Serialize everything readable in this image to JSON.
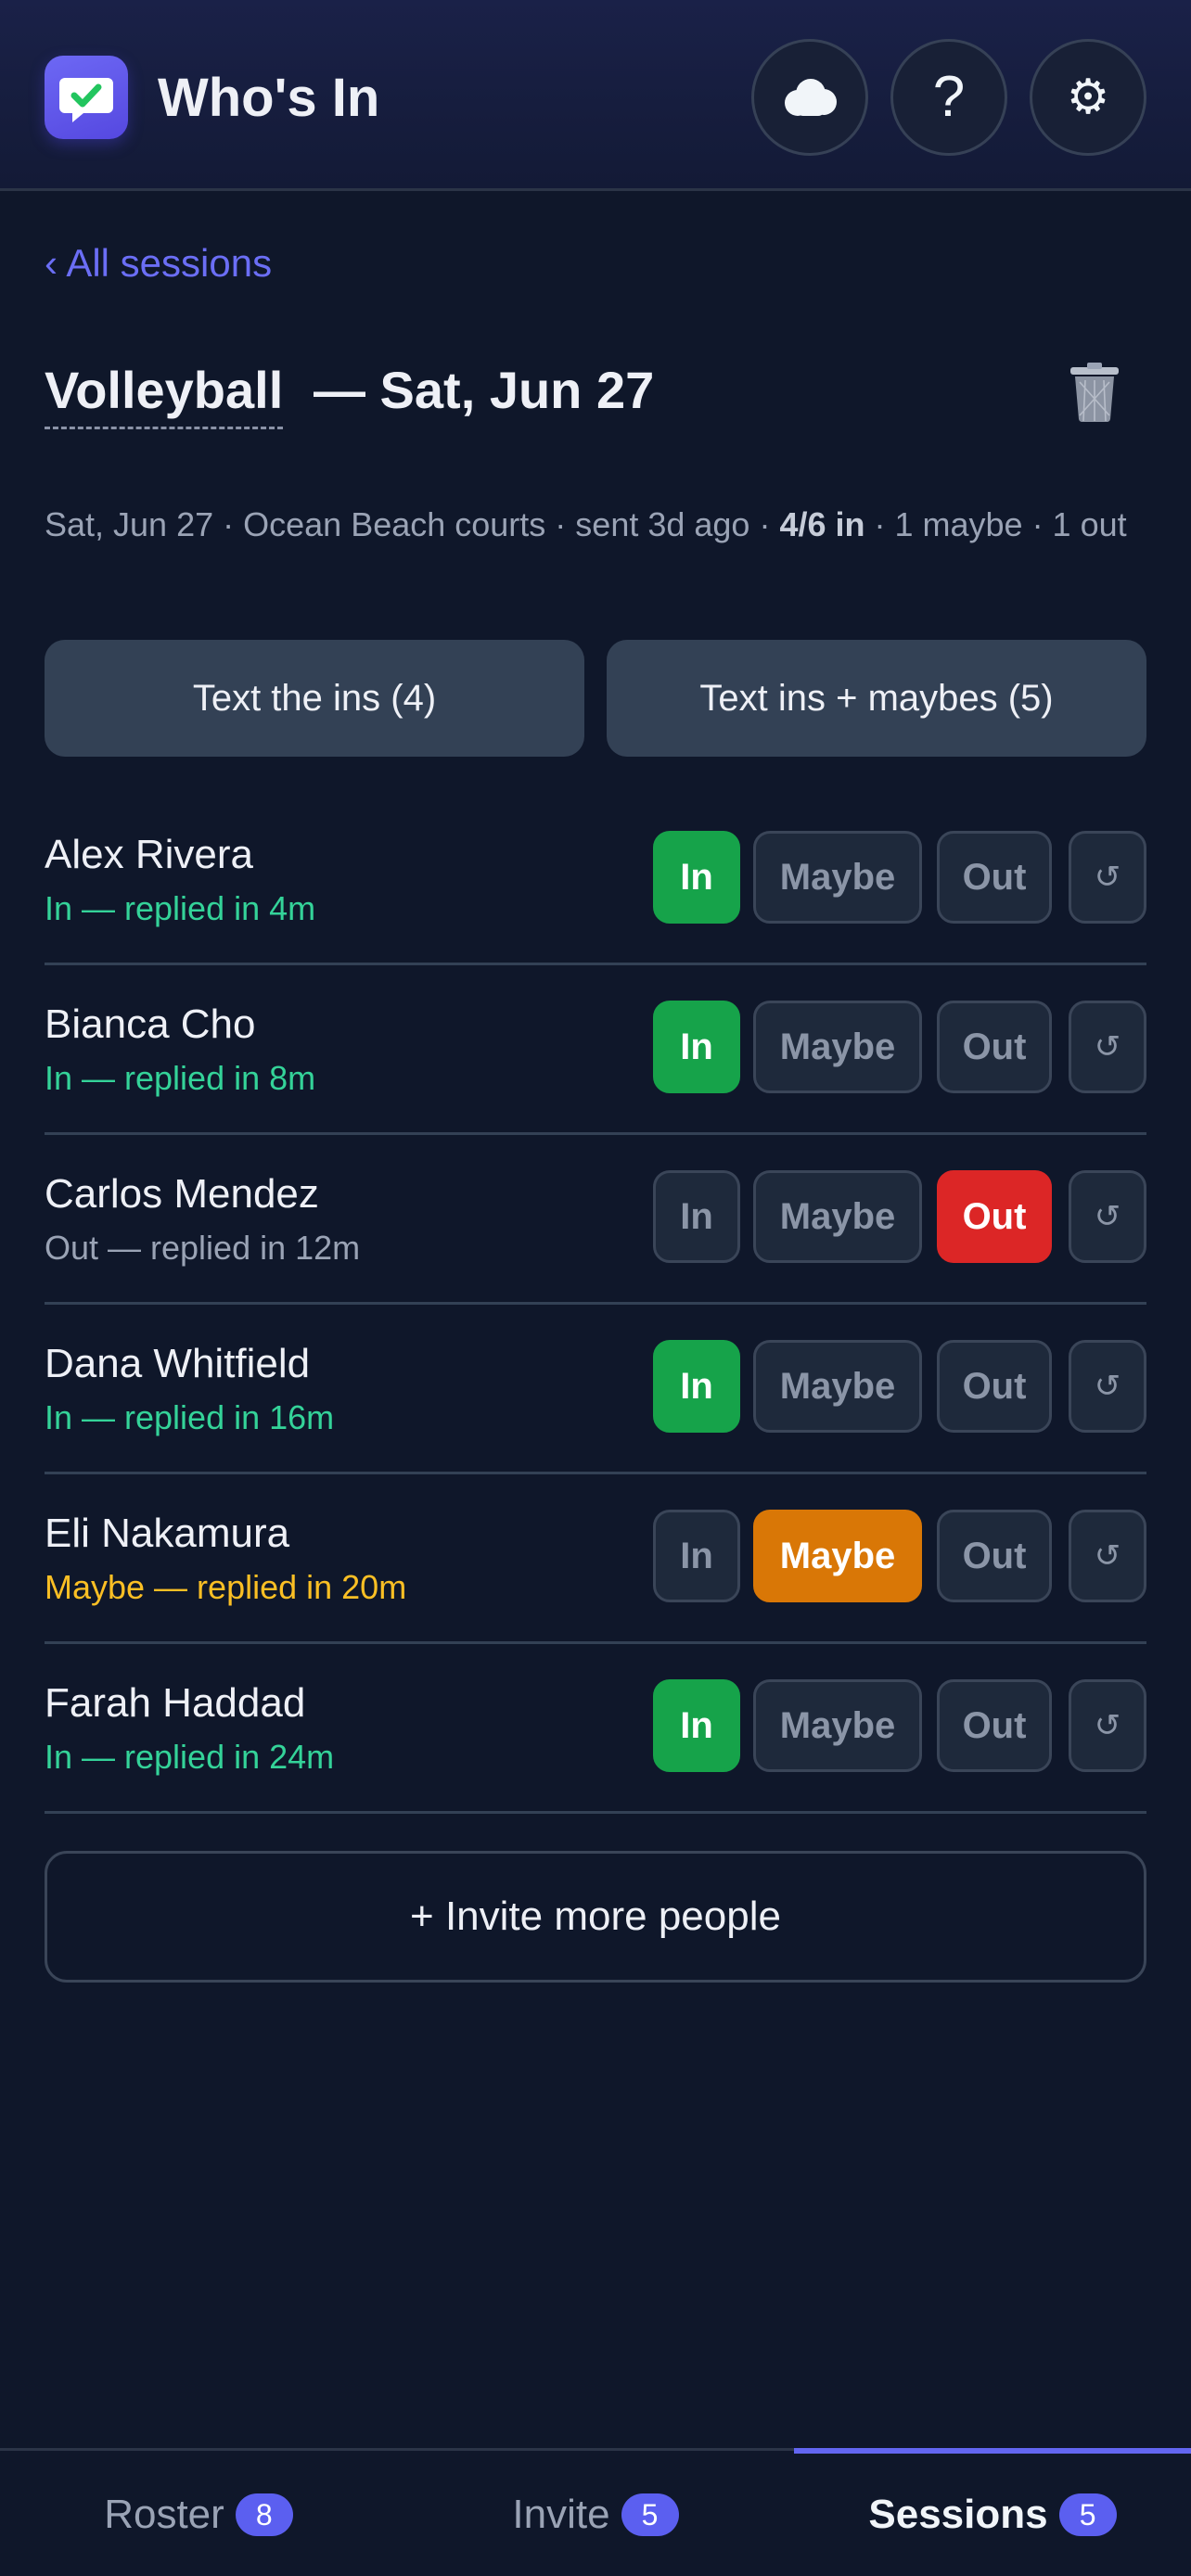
{
  "header": {
    "title": "Who's In",
    "help_label": "?",
    "settings_label": "⚙"
  },
  "back_link": "‹ All sessions",
  "session": {
    "name": "Volleyball",
    "date": "— Sat, Jun 27",
    "summary_prefix": "Sat, Jun 27 · Ocean Beach courts · sent 3d ago · ",
    "summary_count": "4/6 in",
    "summary_suffix": " · 1 maybe · 1 out"
  },
  "actions": {
    "text_ins": "Text the ins (4)",
    "text_ins_maybes": "Text ins + maybes (5)"
  },
  "buttons": {
    "in": "In",
    "maybe": "Maybe",
    "out": "Out",
    "reset": "↺"
  },
  "people": [
    {
      "name": "Alex Rivera",
      "status": "In — replied in 4m",
      "response": "in"
    },
    {
      "name": "Bianca Cho",
      "status": "In — replied in 8m",
      "response": "in"
    },
    {
      "name": "Carlos Mendez",
      "status": "Out — replied in 12m",
      "response": "out"
    },
    {
      "name": "Dana Whitfield",
      "status": "In — replied in 16m",
      "response": "in"
    },
    {
      "name": "Eli Nakamura",
      "status": "Maybe — replied in 20m",
      "response": "maybe"
    },
    {
      "name": "Farah Haddad",
      "status": "In — replied in 24m",
      "response": "in"
    }
  ],
  "invite_more": "+ Invite more people",
  "nav": {
    "roster": {
      "label": "Roster",
      "count": "8"
    },
    "invite": {
      "label": "Invite",
      "count": "5"
    },
    "sessions": {
      "label": "Sessions",
      "count": "5"
    },
    "active": "sessions"
  },
  "colors": {
    "accent": "#6366f1",
    "in": "#16a34a",
    "out": "#dc2626",
    "maybe": "#d97706",
    "background": "#0f172a"
  }
}
